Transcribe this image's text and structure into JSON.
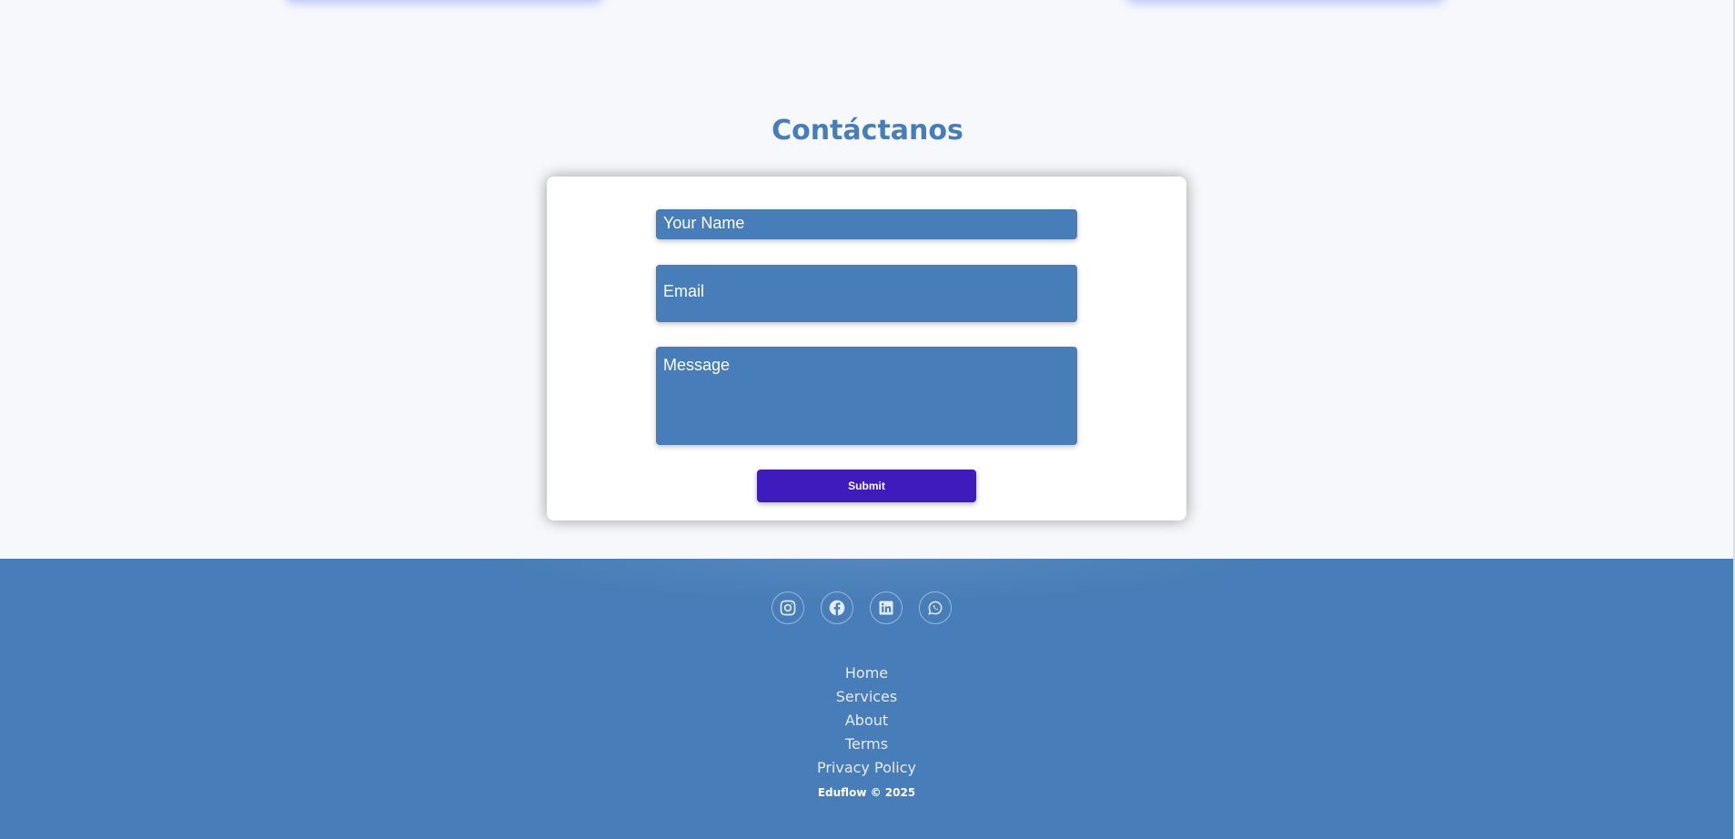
{
  "contact": {
    "title": "Contáctanos",
    "name_placeholder": "Your Name",
    "email_placeholder": "Email",
    "message_placeholder": "Message",
    "submit_label": "Submit"
  },
  "footer": {
    "social": [
      {
        "icon": "instagram-icon"
      },
      {
        "icon": "facebook-icon"
      },
      {
        "icon": "linkedin-icon"
      },
      {
        "icon": "whatsapp-icon"
      }
    ],
    "links": [
      "Home",
      "Services",
      "About",
      "Terms",
      "Privacy Policy"
    ],
    "copyright": "Eduflow © 2025"
  },
  "colors": {
    "accent": "#477db8",
    "submit": "#3d1bbd",
    "background": "#f7f8fc"
  }
}
